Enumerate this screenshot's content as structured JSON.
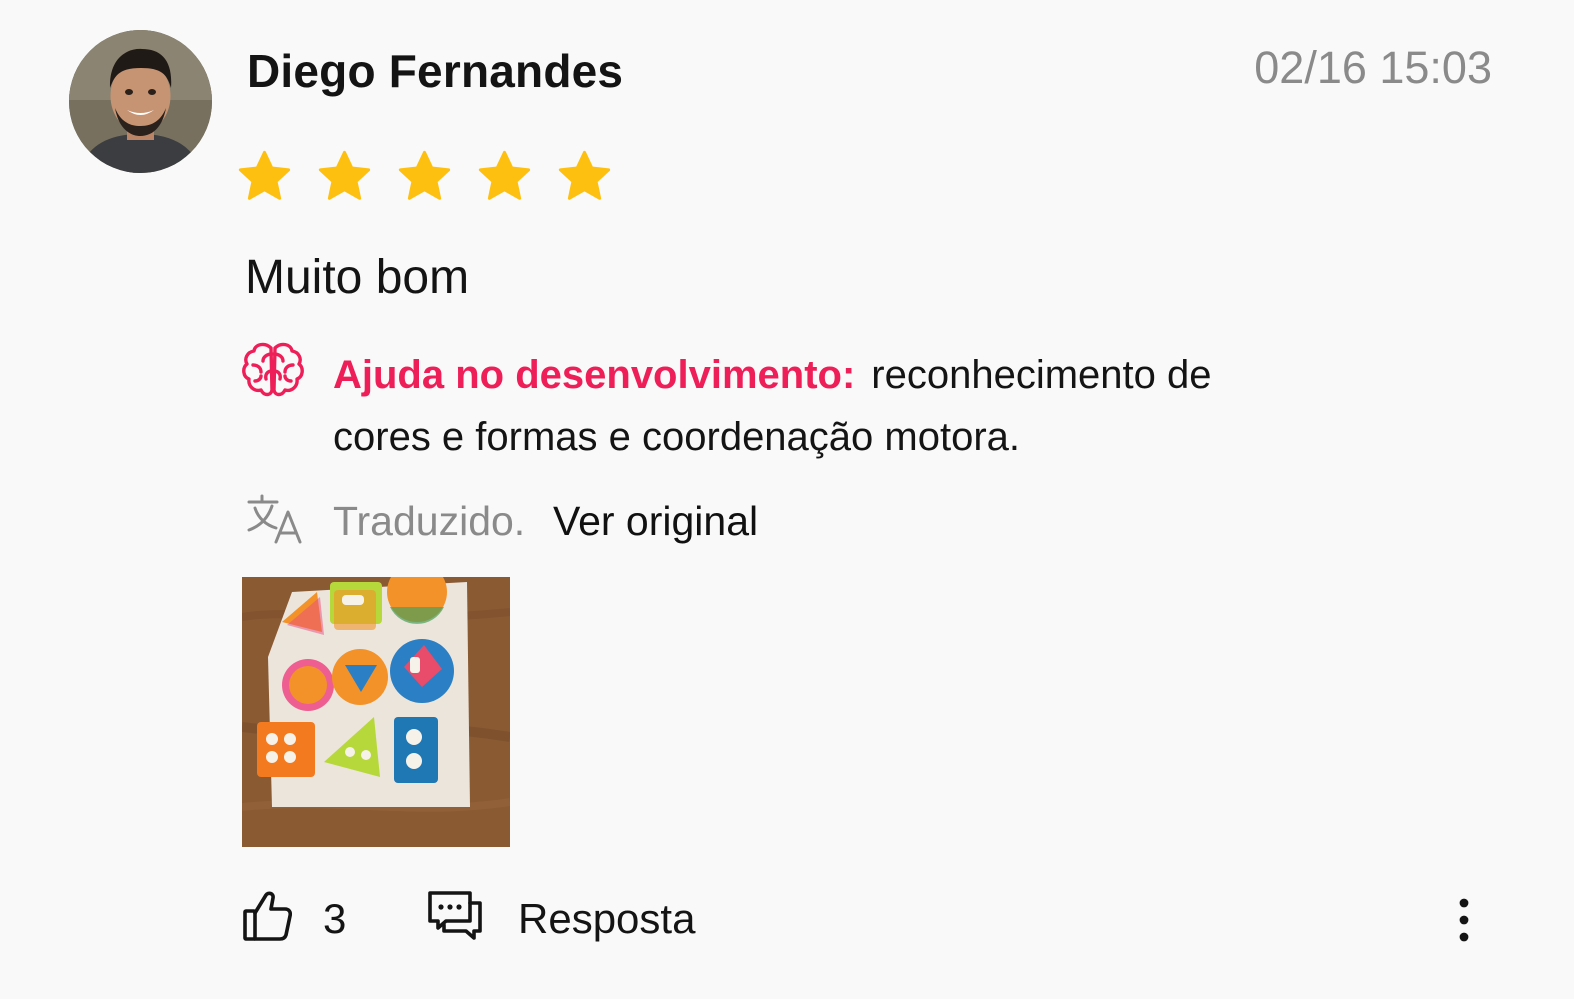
{
  "review": {
    "author": "Diego Fernandes",
    "timestamp": "02/16 15:03",
    "rating": 5,
    "rating_max": 5,
    "title": "Muito bom",
    "highlight": {
      "icon": "brain-icon",
      "label": "Ajuda no desenvolvimento:",
      "text": "reconhecimento de cores e formas e coordenação motora."
    },
    "translation": {
      "icon": "translate-icon",
      "status": "Traduzido.",
      "action": "Ver original"
    },
    "photo": {
      "icon": "review-photo"
    },
    "footer": {
      "like_icon": "thumbs-up-icon",
      "like_count": "3",
      "reply_icon": "chat-bubbles-icon",
      "reply_label": "Resposta",
      "more_icon": "more-vertical-icon"
    }
  },
  "colors": {
    "background": "#f9f9f9",
    "star": "#fec010",
    "highlight_label": "#ee1f58",
    "secondary_text": "#8a8a8a",
    "primary_text": "#141414"
  }
}
